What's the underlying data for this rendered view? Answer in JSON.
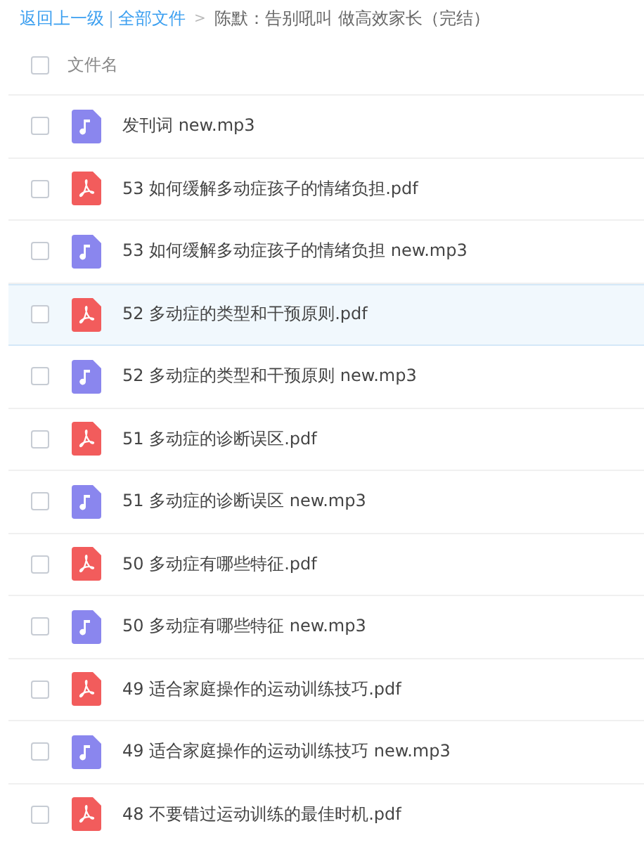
{
  "breadcrumb": {
    "back": "返回上一级",
    "separator": "|",
    "root": "全部文件",
    "arrow": ">",
    "current": "陈默：告别吼叫 做高效家长（完结）"
  },
  "header": {
    "checked": false,
    "label": "文件名"
  },
  "files": [
    {
      "kind": "audio",
      "name": "发刊词 new.mp3",
      "checked": false,
      "highlighted": false
    },
    {
      "kind": "pdf",
      "name": "53 如何缓解多动症孩子的情绪负担.pdf",
      "checked": false,
      "highlighted": false
    },
    {
      "kind": "audio",
      "name": "53 如何缓解多动症孩子的情绪负担 new.mp3",
      "checked": false,
      "highlighted": false
    },
    {
      "kind": "pdf",
      "name": "52 多动症的类型和干预原则.pdf",
      "checked": false,
      "highlighted": true
    },
    {
      "kind": "audio",
      "name": "52 多动症的类型和干预原则 new.mp3",
      "checked": false,
      "highlighted": false
    },
    {
      "kind": "pdf",
      "name": "51 多动症的诊断误区.pdf",
      "checked": false,
      "highlighted": false
    },
    {
      "kind": "audio",
      "name": "51 多动症的诊断误区 new.mp3",
      "checked": false,
      "highlighted": false
    },
    {
      "kind": "pdf",
      "name": "50 多动症有哪些特征.pdf",
      "checked": false,
      "highlighted": false
    },
    {
      "kind": "audio",
      "name": "50 多动症有哪些特征 new.mp3",
      "checked": false,
      "highlighted": false
    },
    {
      "kind": "pdf",
      "name": "49 适合家庭操作的运动训练技巧.pdf",
      "checked": false,
      "highlighted": false
    },
    {
      "kind": "audio",
      "name": "49 适合家庭操作的运动训练技巧 new.mp3",
      "checked": false,
      "highlighted": false
    },
    {
      "kind": "pdf",
      "name": "48 不要错过运动训练的最佳时机.pdf",
      "checked": false,
      "highlighted": false
    }
  ]
}
